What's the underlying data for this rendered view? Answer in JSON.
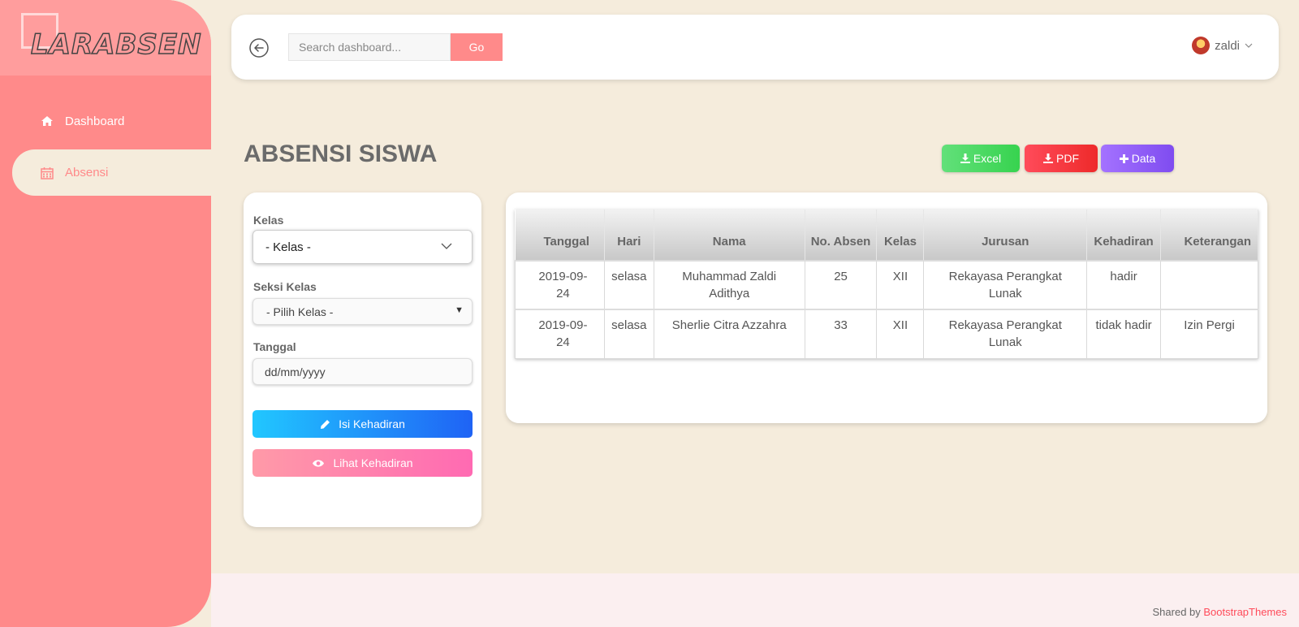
{
  "brand": {
    "logo_text": "LARABSEN"
  },
  "sidebar": {
    "items": [
      {
        "label": "Dashboard",
        "icon": "home-icon",
        "active": false
      },
      {
        "label": "Absensi",
        "icon": "calendar-icon",
        "active": true
      }
    ]
  },
  "topbar": {
    "search_placeholder": "Search dashboard...",
    "go_label": "Go",
    "user_name": "zaldi"
  },
  "page": {
    "title": "ABSENSI SISWA"
  },
  "actions": {
    "excel": "Excel",
    "pdf": "PDF",
    "data": "Data"
  },
  "filter": {
    "kelas_label": "Kelas",
    "kelas_value": "- Kelas -",
    "seksi_label": "Seksi Kelas",
    "seksi_value": "- Pilih Kelas -",
    "tanggal_label": "Tanggal",
    "tanggal_placeholder": "dd/mm/yyyy",
    "isi_button": "Isi Kehadiran",
    "lihat_button": "Lihat Kehadiran"
  },
  "table": {
    "headers": [
      "Tanggal",
      "Hari",
      "Nama",
      "No. Absen",
      "Kelas",
      "Jurusan",
      "Kehadiran",
      "Keterangan"
    ],
    "rows": [
      [
        "2019-09-24",
        "selasa",
        "Muhammad Zaldi Adithya",
        "25",
        "XII",
        "Rekayasa Perangkat Lunak",
        "hadir",
        ""
      ],
      [
        "2019-09-24",
        "selasa",
        "Sherlie Citra Azzahra",
        "33",
        "XII",
        "Rekayasa Perangkat Lunak",
        "tidak hadir",
        "Izin Pergi"
      ]
    ]
  },
  "footer": {
    "prefix": "Shared by",
    "link": "BootstrapThemes"
  },
  "colors": {
    "sidebar": "#ff8a8a",
    "background": "#f5ecdc",
    "excel": "#37d34f",
    "pdf": "#ee2a2a",
    "data": "#7f4cf0"
  }
}
